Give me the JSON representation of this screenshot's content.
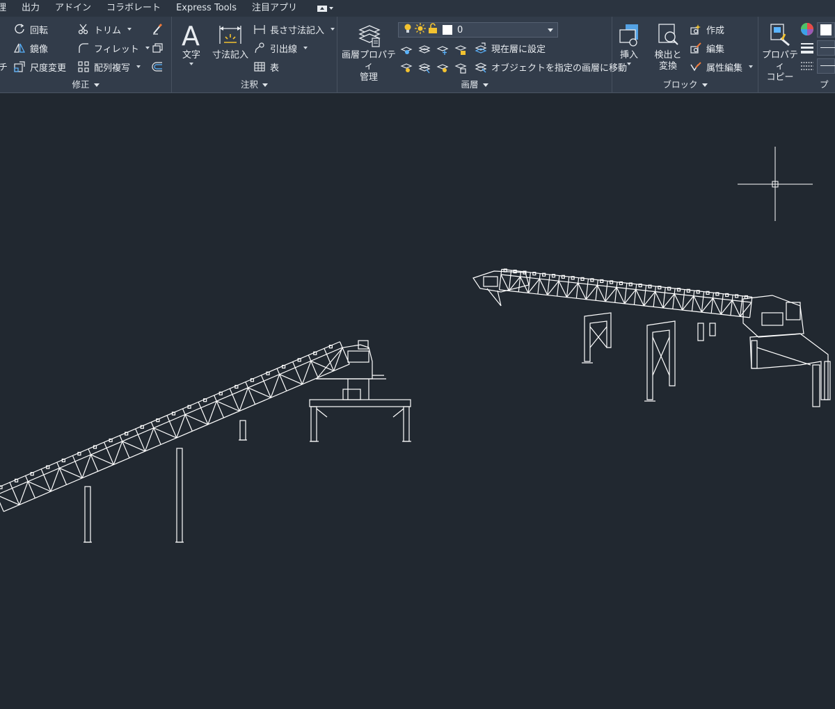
{
  "menu_tabs": [
    "理",
    "出力",
    "アドイン",
    "コラボレート",
    "Express Tools",
    "注目アプリ"
  ],
  "modify": {
    "rotate": "回転",
    "trim": "トリム",
    "mirror": "鏡像",
    "fillet": "フィレット",
    "scale": "尺度変更",
    "array": "配列複写",
    "left_cut": "チ",
    "footer": "修正"
  },
  "annotation": {
    "text": "文字",
    "dimension": "寸法記入",
    "linear": "長さ寸法記入",
    "leader": "引出線",
    "table": "表",
    "footer": "注釈"
  },
  "layers": {
    "properties": "画層プロパティ",
    "manage": "管理",
    "current_layer": "0",
    "set_current": "現在層に設定",
    "move_to_layer": "オブジェクトを指定の画層に移動",
    "footer": "画層"
  },
  "block": {
    "insert": "挿入",
    "find": "検出と",
    "replace": "変換",
    "create": "作成",
    "edit": "編集",
    "attr_edit": "属性編集",
    "footer": "ブロック"
  },
  "properties": {
    "match": "プロパティ",
    "copy": "コピー",
    "footer_cut": "プ"
  },
  "colors": {
    "background": "#212830",
    "ribbon": "#323c4a",
    "menubar": "#2b3440",
    "lines": "#ffffff",
    "icon_blue": "#5ab4ff",
    "icon_yellow": "#f2c230"
  }
}
